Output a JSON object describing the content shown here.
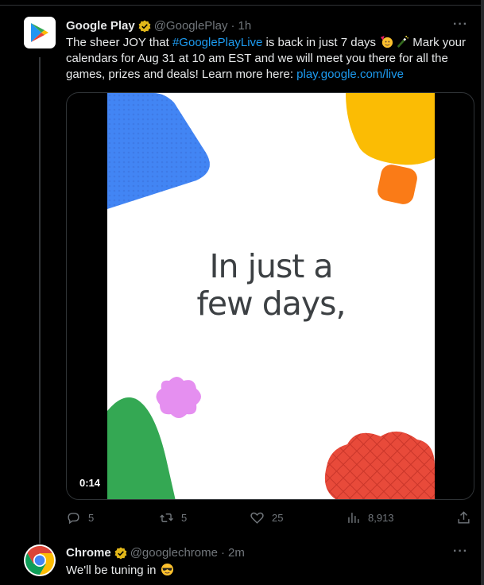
{
  "tweets": [
    {
      "name": "Google Play",
      "handle": "@GooglePlay",
      "dot": "·",
      "time": "1h",
      "more": "···",
      "text_part1": "The sheer JOY that ",
      "hashtag": "#GooglePlayLive",
      "text_part2": " is back in just 7 days ",
      "text_part3": " Mark your calendars for Aug 31 at 10 am EST and we will meet you there for all the games, prizes and deals! Learn more here: ",
      "link": "play.google.com/live",
      "media": {
        "video_text_line1": "In just a",
        "video_text_line2": "few days,",
        "duration": "0:14"
      },
      "actions": {
        "replies": "5",
        "retweets": "5",
        "likes": "25",
        "views": "8,913"
      }
    },
    {
      "name": "Chrome",
      "handle": "@googlechrome",
      "dot": "·",
      "time": "2m",
      "more": "···",
      "text": "We'll be tuning in "
    }
  ],
  "colors": {
    "background": "#000000",
    "link": "#1d9bf0",
    "muted": "#71767b",
    "verified": "#e2b719"
  },
  "icons": [
    "google-play-logo",
    "verified-badge",
    "party-face-emoji",
    "champagne-emoji",
    "reply-icon",
    "retweet-icon",
    "like-icon",
    "views-icon",
    "share-icon",
    "chrome-logo",
    "sunglasses-emoji",
    "more-icon"
  ]
}
